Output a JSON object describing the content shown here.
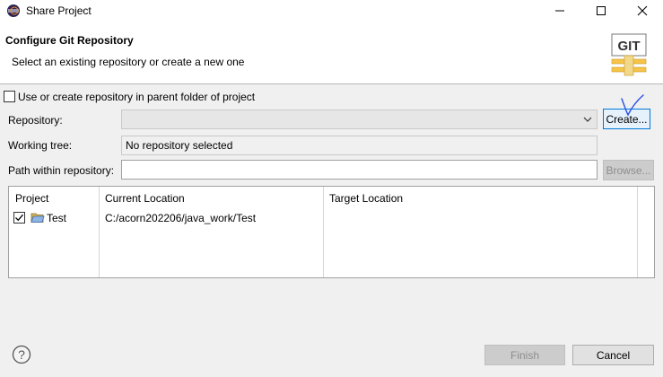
{
  "window": {
    "title": "Share Project"
  },
  "banner": {
    "title": "Configure Git Repository",
    "subtitle": "Select an existing repository or create a new one",
    "logo_text": "GIT"
  },
  "form": {
    "use_parent_label": "Use or create repository in parent folder of project",
    "use_parent_checked": false,
    "repository_label": "Repository:",
    "repository_value": "",
    "create_label": "Create...",
    "working_tree_label": "Working tree:",
    "working_tree_value": "No repository selected",
    "path_label": "Path within repository:",
    "path_value": "",
    "browse_label": "Browse..."
  },
  "table": {
    "headers": [
      "Project",
      "Current Location",
      "Target Location"
    ],
    "rows": [
      {
        "checked": true,
        "project": "Test",
        "current": "C:/acorn202206/java_work/Test",
        "target": ""
      }
    ]
  },
  "footer": {
    "finish_label": "Finish",
    "cancel_label": "Cancel"
  },
  "colors": {
    "accent": "#0078d7",
    "annotation": "#2a4ee8"
  }
}
